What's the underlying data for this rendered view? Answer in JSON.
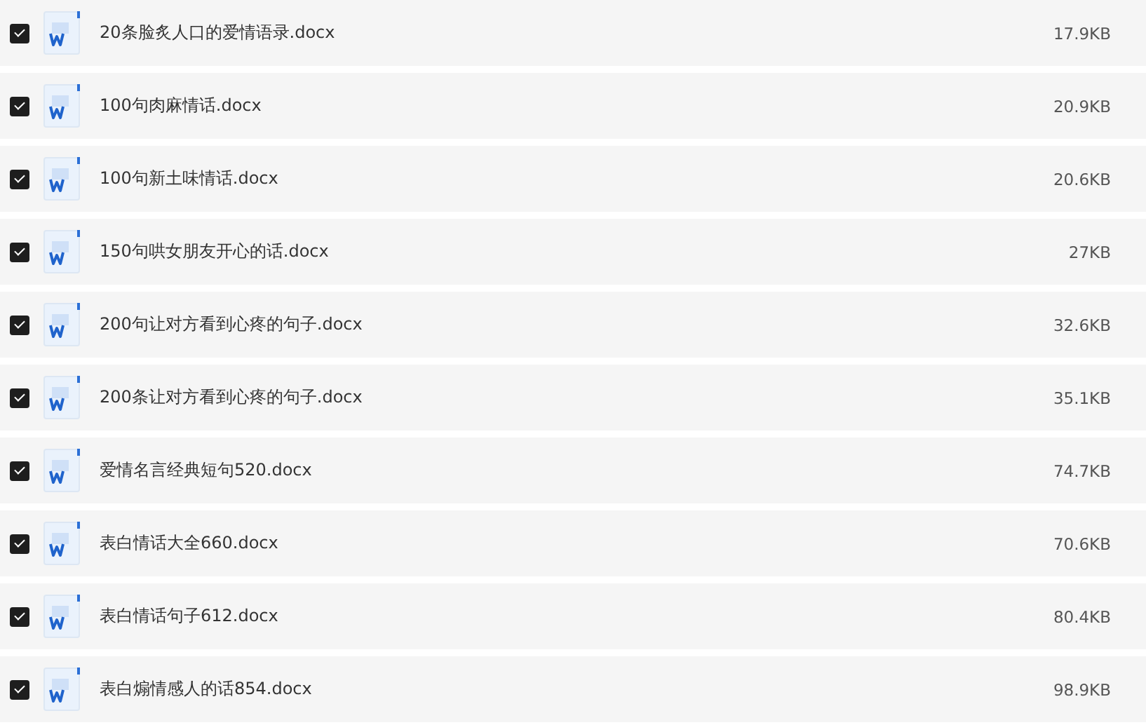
{
  "files": [
    {
      "name": "20条脸炙人口的爱情语录.docx",
      "size": "17.9KB",
      "checked": true
    },
    {
      "name": "100句肉麻情话.docx",
      "size": "20.9KB",
      "checked": true
    },
    {
      "name": "100句新土味情话.docx",
      "size": "20.6KB",
      "checked": true
    },
    {
      "name": "150句哄女朋友开心的话.docx",
      "size": "27KB",
      "checked": true
    },
    {
      "name": "200句让对方看到心疼的句子.docx",
      "size": "32.6KB",
      "checked": true
    },
    {
      "name": "200条让对方看到心疼的句子.docx",
      "size": "35.1KB",
      "checked": true
    },
    {
      "name": "爱情名言经典短句520.docx",
      "size": "74.7KB",
      "checked": true
    },
    {
      "name": "表白情话大全660.docx",
      "size": "70.6KB",
      "checked": true
    },
    {
      "name": "表白情话句子612.docx",
      "size": "80.4KB",
      "checked": true
    },
    {
      "name": "表白煽情感人的话854.docx",
      "size": "98.9KB",
      "checked": true
    }
  ]
}
